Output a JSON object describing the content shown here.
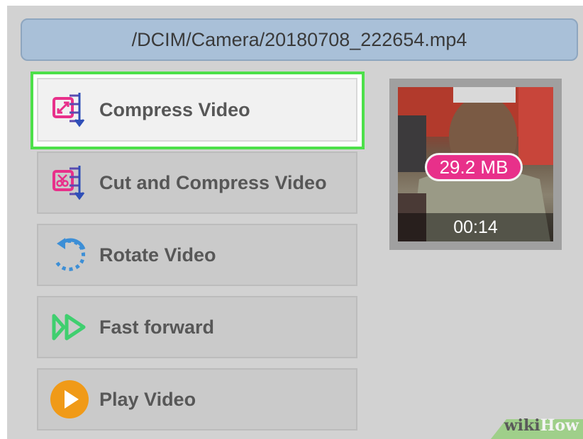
{
  "file_path": "/DCIM/Camera/20180708_222654.mp4",
  "menu": [
    {
      "label": "Compress Video",
      "icon": "compress-icon"
    },
    {
      "label": "Cut and Compress Video",
      "icon": "cut-compress-icon"
    },
    {
      "label": "Rotate Video",
      "icon": "rotate-icon"
    },
    {
      "label": "Fast forward",
      "icon": "fast-forward-icon"
    },
    {
      "label": "Play Video",
      "icon": "play-icon"
    }
  ],
  "thumbnail": {
    "size": "29.2 MB",
    "duration": "00:14"
  },
  "watermark": {
    "wiki": "wiki",
    "how": "How"
  },
  "colors": {
    "highlight": "#4de04a",
    "badge": "#e8308a",
    "path_bar": "#a9c0d8"
  }
}
